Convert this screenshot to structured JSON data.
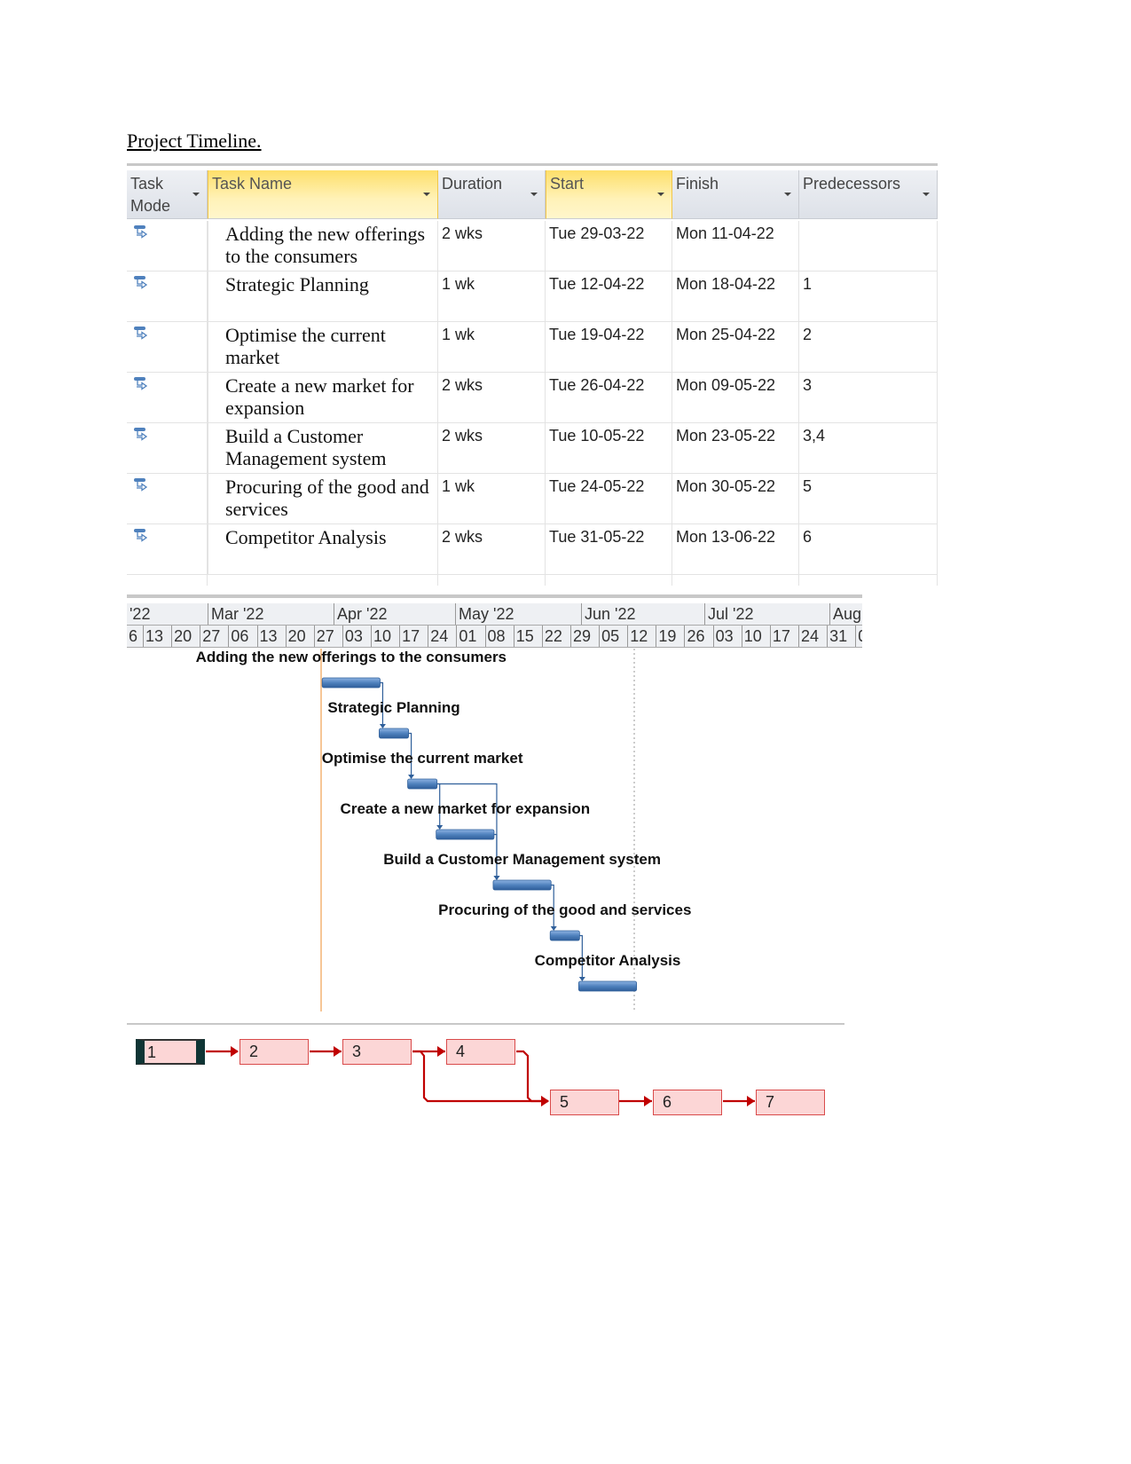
{
  "title": "Project Timeline.",
  "table": {
    "columns": [
      {
        "label": "Task Mode",
        "highlight": false
      },
      {
        "label": "Task Name",
        "highlight": true
      },
      {
        "label": "Duration",
        "highlight": false
      },
      {
        "label": "Start",
        "highlight": true
      },
      {
        "label": "Finish",
        "highlight": false
      },
      {
        "label": "Predecessors",
        "highlight": false
      }
    ],
    "mode_icon": "auto-scheduled-task-icon",
    "rows": [
      {
        "name": "Adding the new offerings to the consumers",
        "duration": "2 wks",
        "start": "Tue 29-03-22",
        "finish": "Mon 11-04-22",
        "predecessors": ""
      },
      {
        "name": "Strategic Planning",
        "duration": "1 wk",
        "start": "Tue 12-04-22",
        "finish": "Mon 18-04-22",
        "predecessors": "1"
      },
      {
        "name": "Optimise the current market",
        "duration": "1 wk",
        "start": "Tue 19-04-22",
        "finish": "Mon 25-04-22",
        "predecessors": "2"
      },
      {
        "name": "Create a new market for expansion",
        "duration": "2 wks",
        "start": "Tue 26-04-22",
        "finish": "Mon 09-05-22",
        "predecessors": "3"
      },
      {
        "name": "Build a Customer Management system",
        "duration": "2 wks",
        "start": "Tue 10-05-22",
        "finish": "Mon 23-05-22",
        "predecessors": "3,4"
      },
      {
        "name": "Procuring of the good and services",
        "duration": "1 wk",
        "start": "Tue 24-05-22",
        "finish": "Mon 30-05-22",
        "predecessors": "5"
      },
      {
        "name": "Competitor Analysis",
        "duration": "2 wks",
        "start": "Tue 31-05-22",
        "finish": "Mon 13-06-22",
        "predecessors": "6"
      }
    ]
  },
  "gantt": {
    "months": [
      "'22",
      "Mar '22",
      "Apr '22",
      "May '22",
      "Jun '22",
      "Jul '22",
      "Aug"
    ],
    "weeks": [
      "6",
      "13",
      "20",
      "27",
      "06",
      "13",
      "20",
      "27",
      "03",
      "10",
      "17",
      "24",
      "01",
      "08",
      "15",
      "22",
      "29",
      "05",
      "12",
      "19",
      "26",
      "03",
      "10",
      "17",
      "24",
      "31",
      "0"
    ],
    "bar_color": "#4f81bd",
    "today_line_color": "#f0a050",
    "tasks": [
      {
        "label": "Adding the new offerings to the consumers",
        "start": "2022-03-29",
        "finish": "2022-04-11",
        "pred": []
      },
      {
        "label": "Strategic Planning",
        "start": "2022-04-12",
        "finish": "2022-04-18",
        "pred": [
          1
        ]
      },
      {
        "label": "Optimise the current market",
        "start": "2022-04-19",
        "finish": "2022-04-25",
        "pred": [
          2
        ]
      },
      {
        "label": "Create a new market for expansion",
        "start": "2022-04-26",
        "finish": "2022-05-09",
        "pred": [
          3
        ]
      },
      {
        "label": "Build a Customer Management system",
        "start": "2022-05-10",
        "finish": "2022-05-23",
        "pred": [
          3,
          4
        ]
      },
      {
        "label": "Procuring of the good and services",
        "start": "2022-05-24",
        "finish": "2022-05-30",
        "pred": [
          5
        ]
      },
      {
        "label": "Competitor Analysis",
        "start": "2022-05-31",
        "finish": "2022-06-13",
        "pred": [
          6
        ]
      }
    ]
  },
  "network": {
    "nodes": [
      "1",
      "2",
      "3",
      "4",
      "5",
      "6",
      "7"
    ],
    "selected": "1",
    "link_color": "#c00000"
  }
}
